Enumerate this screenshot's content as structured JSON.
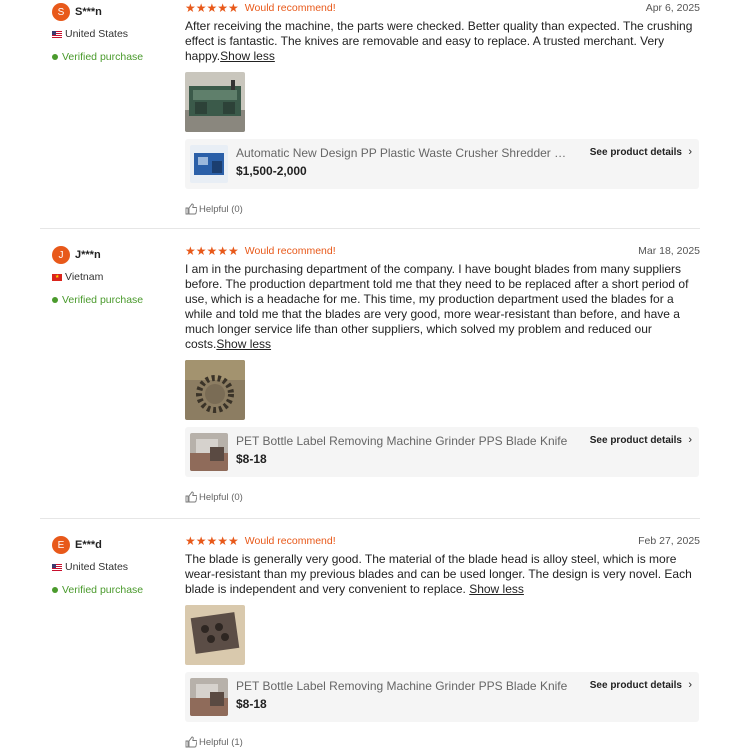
{
  "reviews": [
    {
      "avatar_letter": "S",
      "username": "S***n",
      "country": "United States",
      "flag": "us-flag-icon",
      "verified": "Verified purchase",
      "stars": "★★★★★",
      "recommend": "Would recommend!",
      "date": "Apr 6, 2025",
      "text": "After receiving the machine, the parts were checked. Better quality than expected. The crushing effect is fantastic. The knives are removable and easy to replace. A trusted merchant. Very happy.",
      "show_less": "Show less",
      "product_title": "Automatic New Design PP Plastic Waste Crusher Shredder Machine",
      "product_price": "$1,500-2,000",
      "see_details": "See product details",
      "helpful": "Helpful (0)"
    },
    {
      "avatar_letter": "J",
      "username": "J***n",
      "country": "Vietnam",
      "flag": "vn-flag-icon",
      "verified": "Verified purchase",
      "stars": "★★★★★",
      "recommend": "Would recommend!",
      "date": "Mar 18, 2025",
      "text": "I am in the purchasing department of the company. I have bought blades from many suppliers before. The production department told me that they need to be replaced after a short period of use, which is a headache for me. This time, my production department used the blades for a while and told me that the blades are very good, more wear-resistant than before, and have a much longer service life than other suppliers, which solved my problem and reduced our costs.",
      "show_less": "Show less",
      "product_title": "PET Bottle Label Removing Machine Grinder PPS Blade Knife",
      "product_price": "$8-18",
      "see_details": "See product details",
      "helpful": "Helpful (0)"
    },
    {
      "avatar_letter": "E",
      "username": "E***d",
      "country": "United States",
      "flag": "us-flag-icon",
      "verified": "Verified purchase",
      "stars": "★★★★★",
      "recommend": "Would recommend!",
      "date": "Feb 27, 2025",
      "text": "The blade is generally very good. The material of the blade head is alloy steel, which is more wear-resistant than my previous blades and can be used longer. The design is very novel. Each blade is independent and very convenient to replace. ",
      "show_less": "Show less",
      "product_title": "PET Bottle Label Removing Machine Grinder PPS Blade Knife",
      "product_price": "$8-18",
      "see_details": "See product details",
      "helpful": "Helpful (1)"
    }
  ],
  "colors": {
    "accent": "#e8591a",
    "verified": "#4a9a2c",
    "product_bg": "#f5f5f5"
  }
}
